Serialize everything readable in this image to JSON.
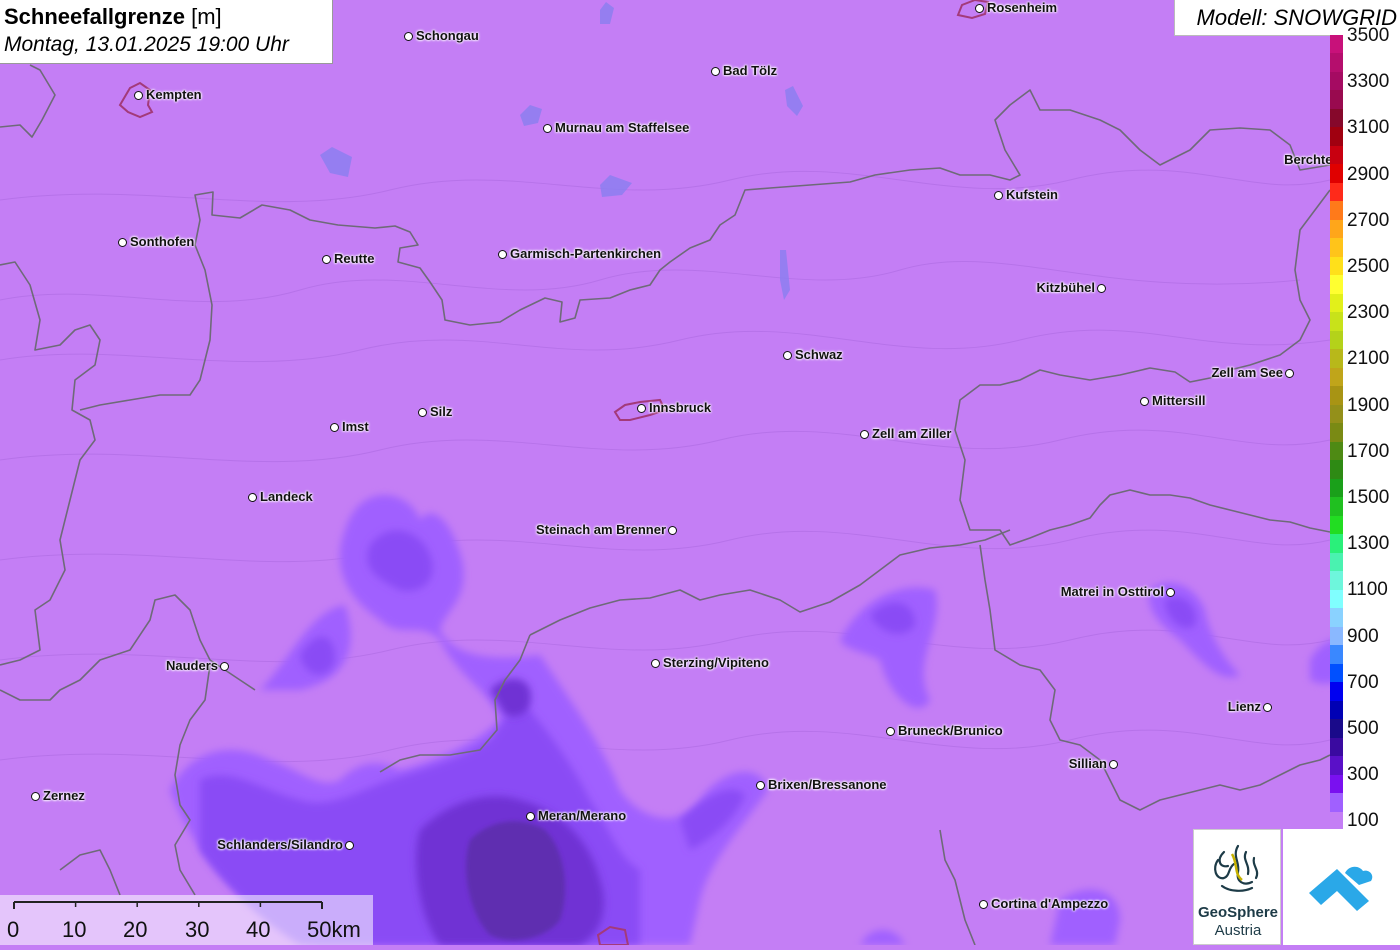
{
  "header": {
    "title": "Schneefallgrenze",
    "unit": "[m]",
    "datetime": "Montag, 13.01.2025 19:00 Uhr",
    "model": "Modell: SNOWGRID"
  },
  "legend": {
    "labels": [
      "3500",
      "3300",
      "3100",
      "2900",
      "2700",
      "2500",
      "2300",
      "2100",
      "1900",
      "1700",
      "1500",
      "1300",
      "1100",
      "900",
      "700",
      "500",
      "300",
      "100"
    ],
    "colors": [
      "#c8117a",
      "#b50e6d",
      "#a50b62",
      "#990a4f",
      "#86082b",
      "#a00010",
      "#c80010",
      "#e00000",
      "#ff2a1a",
      "#ff7a1a",
      "#ffa61a",
      "#ffc41a",
      "#ffe01a",
      "#ffff30",
      "#e2f01a",
      "#c8e21a",
      "#b4d21a",
      "#b8b81a",
      "#c0a51a",
      "#a89414",
      "#94901a",
      "#7a8a14",
      "#4e8a14",
      "#2e8a14",
      "#1aa01a",
      "#20c020",
      "#22dd22",
      "#2af07a",
      "#4af2b0",
      "#6ef6dc",
      "#80ffff",
      "#8ad2ff",
      "#8ab8ff",
      "#3a88ff",
      "#0050ff",
      "#0000f0",
      "#0000b4",
      "#1a0a8a",
      "#3a0aa0",
      "#5a10c8",
      "#7a10f0",
      "#a060ff",
      "#c47ef5"
    ]
  },
  "cities": [
    {
      "name": "Rosenheim",
      "side": "right"
    },
    {
      "name": "Schongau",
      "side": "right"
    },
    {
      "name": "Bad Tölz",
      "side": "right"
    },
    {
      "name": "Kempten",
      "side": "right"
    },
    {
      "name": "Murnau am Staffelsee",
      "side": "right"
    },
    {
      "name": "Berchtesgaden",
      "side": "left"
    },
    {
      "name": "Kufstein",
      "side": "right"
    },
    {
      "name": "Sonthofen",
      "side": "right"
    },
    {
      "name": "Reutte",
      "side": "right"
    },
    {
      "name": "Garmisch-Partenkirchen",
      "side": "right"
    },
    {
      "name": "Kitzbühel",
      "side": "left"
    },
    {
      "name": "Schwaz",
      "side": "right"
    },
    {
      "name": "Zell am See",
      "side": "left"
    },
    {
      "name": "Mittersill",
      "side": "right"
    },
    {
      "name": "Innsbruck",
      "side": "right"
    },
    {
      "name": "Silz",
      "side": "right"
    },
    {
      "name": "Imst",
      "side": "right"
    },
    {
      "name": "Zell am Ziller",
      "side": "right"
    },
    {
      "name": "Landeck",
      "side": "right"
    },
    {
      "name": "Steinach am Brenner",
      "side": "left"
    },
    {
      "name": "Matrei in Osttirol",
      "side": "left"
    },
    {
      "name": "Nauders",
      "side": "left"
    },
    {
      "name": "Sterzing/Vipiteno",
      "side": "right"
    },
    {
      "name": "Lienz",
      "side": "left"
    },
    {
      "name": "Bruneck/Brunico",
      "side": "right"
    },
    {
      "name": "Sillian",
      "side": "left"
    },
    {
      "name": "Brixen/Bressanone",
      "side": "right"
    },
    {
      "name": "Zernez",
      "side": "right"
    },
    {
      "name": "Meran/Merano",
      "side": "right"
    },
    {
      "name": "Schlanders/Silandro",
      "side": "left"
    },
    {
      "name": "Cortina d'Ampezzo",
      "side": "right"
    }
  ],
  "scalebar": {
    "labels": [
      "0",
      "10",
      "20",
      "30",
      "40",
      "50km"
    ]
  },
  "logos": {
    "geosphere_line1": "GeoSphere",
    "geosphere_line2": "Austria"
  }
}
